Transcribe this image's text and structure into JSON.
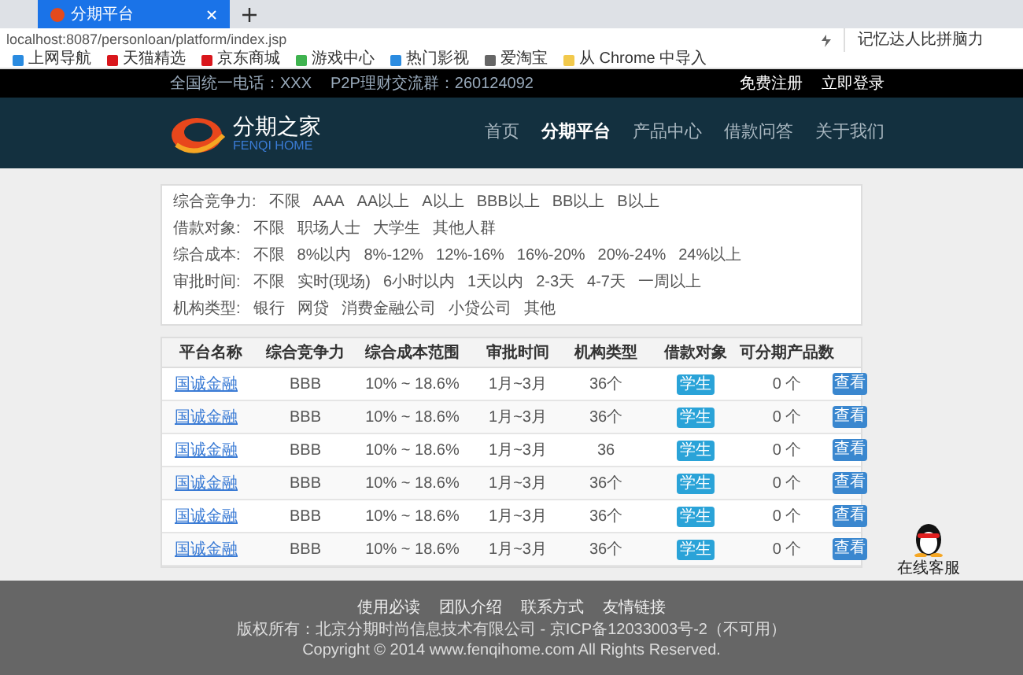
{
  "browser": {
    "tabs": [
      {
        "label": "分期平台",
        "selected": true
      }
    ],
    "address": "localhost:8087/personloan/platform/index.jsp",
    "side_text": "记忆达人比拼脑力",
    "bookmarks": [
      {
        "label": "上网导航",
        "color": "#2a8be0"
      },
      {
        "label": "天猫精选",
        "color": "#d9161c"
      },
      {
        "label": "京东商城",
        "color": "#d9161c"
      },
      {
        "label": "游戏中心",
        "color": "#3fb34f"
      },
      {
        "label": "热门影视",
        "color": "#2a8be0"
      },
      {
        "label": "爱淘宝",
        "color": "#666666"
      },
      {
        "label": "从 Chrome 中导入",
        "color": "#f2c94c"
      }
    ]
  },
  "top_bar": {
    "hotline": "全国统一电话：XXX",
    "group": "P2P理财交流群：260124092",
    "links": [
      "免费注册",
      "立即登录"
    ]
  },
  "header": {
    "logo_title": "分期之家",
    "logo_subtitle": "FENQI HOME",
    "nav": [
      {
        "label": "首页",
        "selected": false
      },
      {
        "label": "分期平台",
        "selected": true
      },
      {
        "label": "产品中心",
        "selected": false
      },
      {
        "label": "借款问答",
        "selected": false
      },
      {
        "label": "关于我们",
        "selected": false
      }
    ]
  },
  "filters": [
    {
      "label": "综合竞争力:",
      "options": [
        "不限",
        "AAA",
        "AA以上",
        "A以上",
        "BBB以上",
        "BB以上",
        "B以上"
      ]
    },
    {
      "label": "借款对象:",
      "options": [
        "不限",
        "职场人士",
        "大学生",
        "其他人群"
      ]
    },
    {
      "label": "综合成本:",
      "options": [
        "不限",
        "8%以内",
        "8%-12%",
        "12%-16%",
        "16%-20%",
        "20%-24%",
        "24%以上"
      ]
    },
    {
      "label": "审批时间:",
      "options": [
        "不限",
        "实时(现场)",
        "6小时以内",
        "1天以内",
        "2-3天",
        "4-7天",
        "一周以上"
      ]
    },
    {
      "label": "机构类型:",
      "options": [
        "银行",
        "网贷",
        "消费金融公司",
        "小贷公司",
        "其他"
      ]
    }
  ],
  "table": {
    "columns": [
      "平台名称",
      "综合竞争力",
      "综合成本范围",
      "审批时间",
      "机构类型",
      "借款对象",
      "可分期产品数"
    ],
    "rows": [
      {
        "name": "国诚金融",
        "rating": "BBB",
        "cost": "10% ~ 18.6%",
        "time": "1月~3月",
        "type": "36个",
        "target": "学生",
        "products": "0 个",
        "action": "查看"
      },
      {
        "name": "国诚金融",
        "rating": "BBB",
        "cost": "10% ~ 18.6%",
        "time": "1月~3月",
        "type": "36个",
        "target": "学生",
        "products": "0 个",
        "action": "查看"
      },
      {
        "name": "国诚金融",
        "rating": "BBB",
        "cost": "10% ~ 18.6%",
        "time": "1月~3月",
        "type": "36",
        "target": "学生",
        "products": "0 个",
        "action": "查看"
      },
      {
        "name": "国诚金融",
        "rating": "BBB",
        "cost": "10% ~ 18.6%",
        "time": "1月~3月",
        "type": "36个",
        "target": "学生",
        "products": "0 个",
        "action": "查看"
      },
      {
        "name": "国诚金融",
        "rating": "BBB",
        "cost": "10% ~ 18.6%",
        "time": "1月~3月",
        "type": "36个",
        "target": "学生",
        "products": "0 个",
        "action": "查看"
      },
      {
        "name": "国诚金融",
        "rating": "BBB",
        "cost": "10% ~ 18.6%",
        "time": "1月~3月",
        "type": "36个",
        "target": "学生",
        "products": "0 个",
        "action": "查看"
      }
    ]
  },
  "service": {
    "label": "在线客服"
  },
  "footer": {
    "links": [
      "使用必读",
      "团队介绍",
      "联系方式",
      "友情链接"
    ],
    "copyright": "版权所有：北京分期时尚信息技术有限公司 - 京ICP备12033003号-2（不可用）",
    "notice": "Copyright © 2014 www.fenqihome.com All Rights Reserved."
  }
}
